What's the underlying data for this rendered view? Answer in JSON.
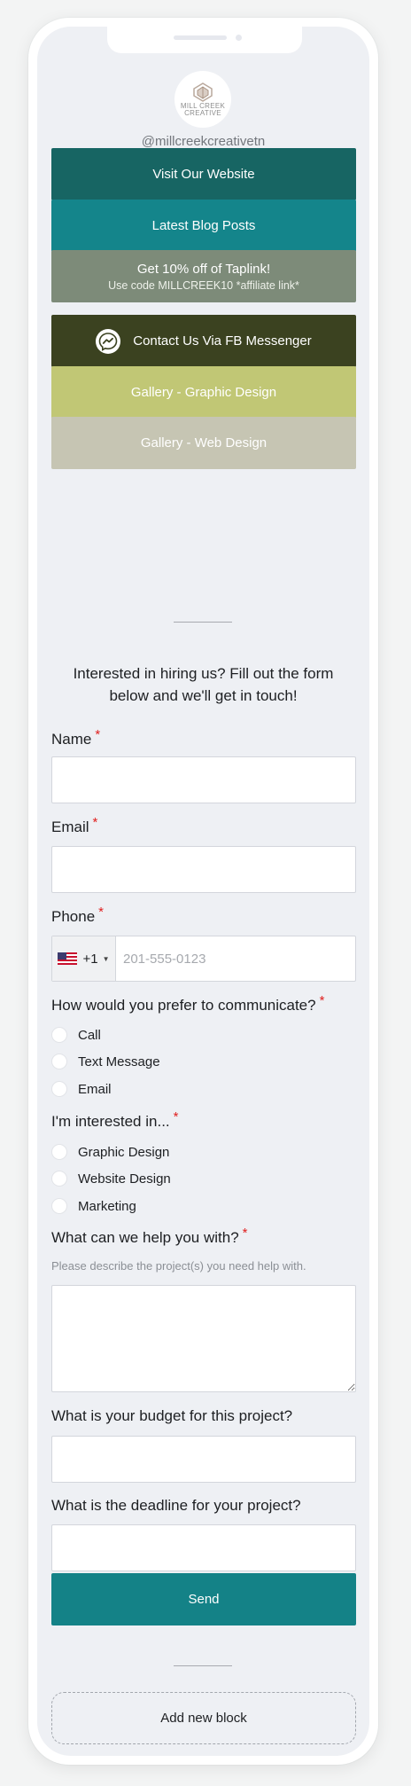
{
  "profile": {
    "logo_text": "MILL CREEK\nCREATIVE",
    "username": "@millcreekcreativetn"
  },
  "links": [
    {
      "label": "Visit Our Website",
      "color": "#176563"
    },
    {
      "label": "Latest Blog Posts",
      "color": "#14858b"
    },
    {
      "label": "Get 10% off of Taplink!",
      "sublabel": "Use code MILLCREEK10 *affiliate link*",
      "color": "#7d8b79"
    },
    {
      "label": "Contact Us Via FB Messenger",
      "icon": "messenger-icon",
      "color": "#3b4220"
    },
    {
      "label": "Gallery - Graphic Design",
      "color": "#c1c775"
    },
    {
      "label": "Gallery - Web Design",
      "color": "#c6c5b3"
    }
  ],
  "form": {
    "intro": "Interested in hiring us? Fill out the form below and we'll get in touch!",
    "required_mark": "*",
    "name_label": "Name",
    "email_label": "Email",
    "phone_label": "Phone",
    "phone_country_code": "+1",
    "phone_placeholder": "201-555-0123",
    "communicate_label": "How would you prefer to communicate?",
    "communicate_options": [
      "Call",
      "Text Message",
      "Email"
    ],
    "interest_label": "I'm interested in...",
    "interest_options": [
      "Graphic Design",
      "Website Design",
      "Marketing"
    ],
    "help_label": "What can we help you with?",
    "help_hint": "Please describe the project(s) you need help with.",
    "budget_label": "What is your budget for this project?",
    "deadline_label": "What is the deadline for your project?",
    "send_label": "Send"
  },
  "footer": {
    "add_block_label": "Add new block"
  }
}
